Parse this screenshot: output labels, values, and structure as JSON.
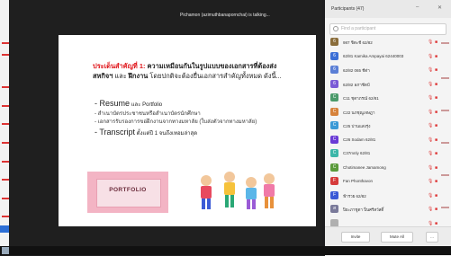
{
  "meeting": {
    "speaker_banner": "Pichamon (azimuthbanapornchai) is talking..."
  },
  "slide": {
    "heading_prefix": "ประเด็นสำคัญที่ 1:",
    "heading_bold": "ความเหมือนกันในรูปแบบของเอกสารที่ต้องส่ง",
    "heading_line2_bold": "สหกิจฯ",
    "heading_line2_mid": " และ ",
    "heading_line2_bold2": "ฝึกงาน",
    "heading_line2_normal": " โดยปกติจะต้องยื่นเอกสารสำคัญทั้งหมด ดังนี้...",
    "bullets": [
      {
        "text": "- Resume",
        "sub": " และ Portfolio",
        "big": true
      },
      {
        "text": "- สำเนาบัตรประชาชนหรือสำเนาบัตรนักศึกษา",
        "big": false
      },
      {
        "text": "- เอกสารรับรองการขอฝึกงานจากทางมหาลัย (ใบส่งตัวจากทางมหาลัย)",
        "big": false
      },
      {
        "text": "- Transcript",
        "sub": " ตั้งแต่ปี 1 จนถึงเทอมล่าสุด",
        "big": true
      }
    ],
    "portfolio_word": "PORTFOLIO"
  },
  "participants": {
    "title": "Participants (47)",
    "search_placeholder": "Find a participant",
    "rows": [
      {
        "initial": "6",
        "name": "987 ชิตะชี 62/82",
        "color": "#8a6d3b"
      },
      {
        "initial": "6",
        "name": "62/81 Kamika Ampayai 62440003",
        "color": "#3b6fd6"
      },
      {
        "initial": "6",
        "name": "62/82 065 ชีด่า",
        "color": "#5b7fd6"
      },
      {
        "initial": "6",
        "name": "62/82 ลภาชีดป์",
        "color": "#7a5bd6"
      },
      {
        "initial": "C",
        "name": "C11 ชุดาภรณ์ 62/81",
        "color": "#4a9a6a"
      },
      {
        "initial": "C",
        "name": "C22 นภชุณูเจษฎา",
        "color": "#d6823b"
      },
      {
        "initial": "C",
        "name": "C25 ปานแสงรุ่ง",
        "color": "#3b9ad6"
      },
      {
        "initial": "C",
        "name": "C26 Sodam 62/81",
        "color": "#6a3bd6"
      },
      {
        "initial": "C",
        "name": "C37mnly 62/81",
        "color": "#3bb6a8"
      },
      {
        "initial": "C",
        "name": "Chotimanee Jamamong",
        "color": "#5a9a3b"
      },
      {
        "initial": "F",
        "name": "Fan Phonthavon",
        "color": "#d63b3b"
      },
      {
        "initial": "F",
        "name": "ฟ้ารวย 62/82",
        "color": "#3b5ad6"
      },
      {
        "initial": "ส",
        "name": "ปิยะภาชูดา ปิ่นศรีสวัสดิ์",
        "color": "#7a7a9a"
      },
      {
        "initial": "",
        "name": "",
        "color": "#b0b0b0"
      }
    ],
    "invite_label": "Invite",
    "mute_all_label": "Mute All",
    "more_label": "..."
  }
}
